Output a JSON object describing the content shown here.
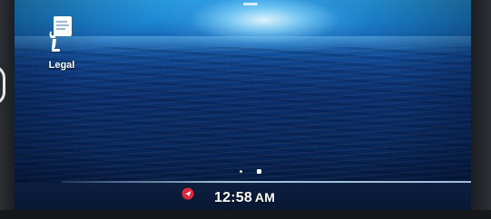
{
  "home_screen": {
    "apps": [
      {
        "label": "Legal",
        "icon": "legal-document-icon"
      }
    ],
    "page_indicator": {
      "page_count": 2,
      "current_page": 2
    }
  },
  "status_bar": {
    "clock": {
      "time": "12:58",
      "ampm": "AM"
    },
    "indicator_icon": "location-icon",
    "indicator_color": "#e0263c"
  },
  "colors": {
    "sky_glow": "#bfe9ff",
    "ocean_deep": "#071e47",
    "status_bar": "#0c1f3f"
  }
}
